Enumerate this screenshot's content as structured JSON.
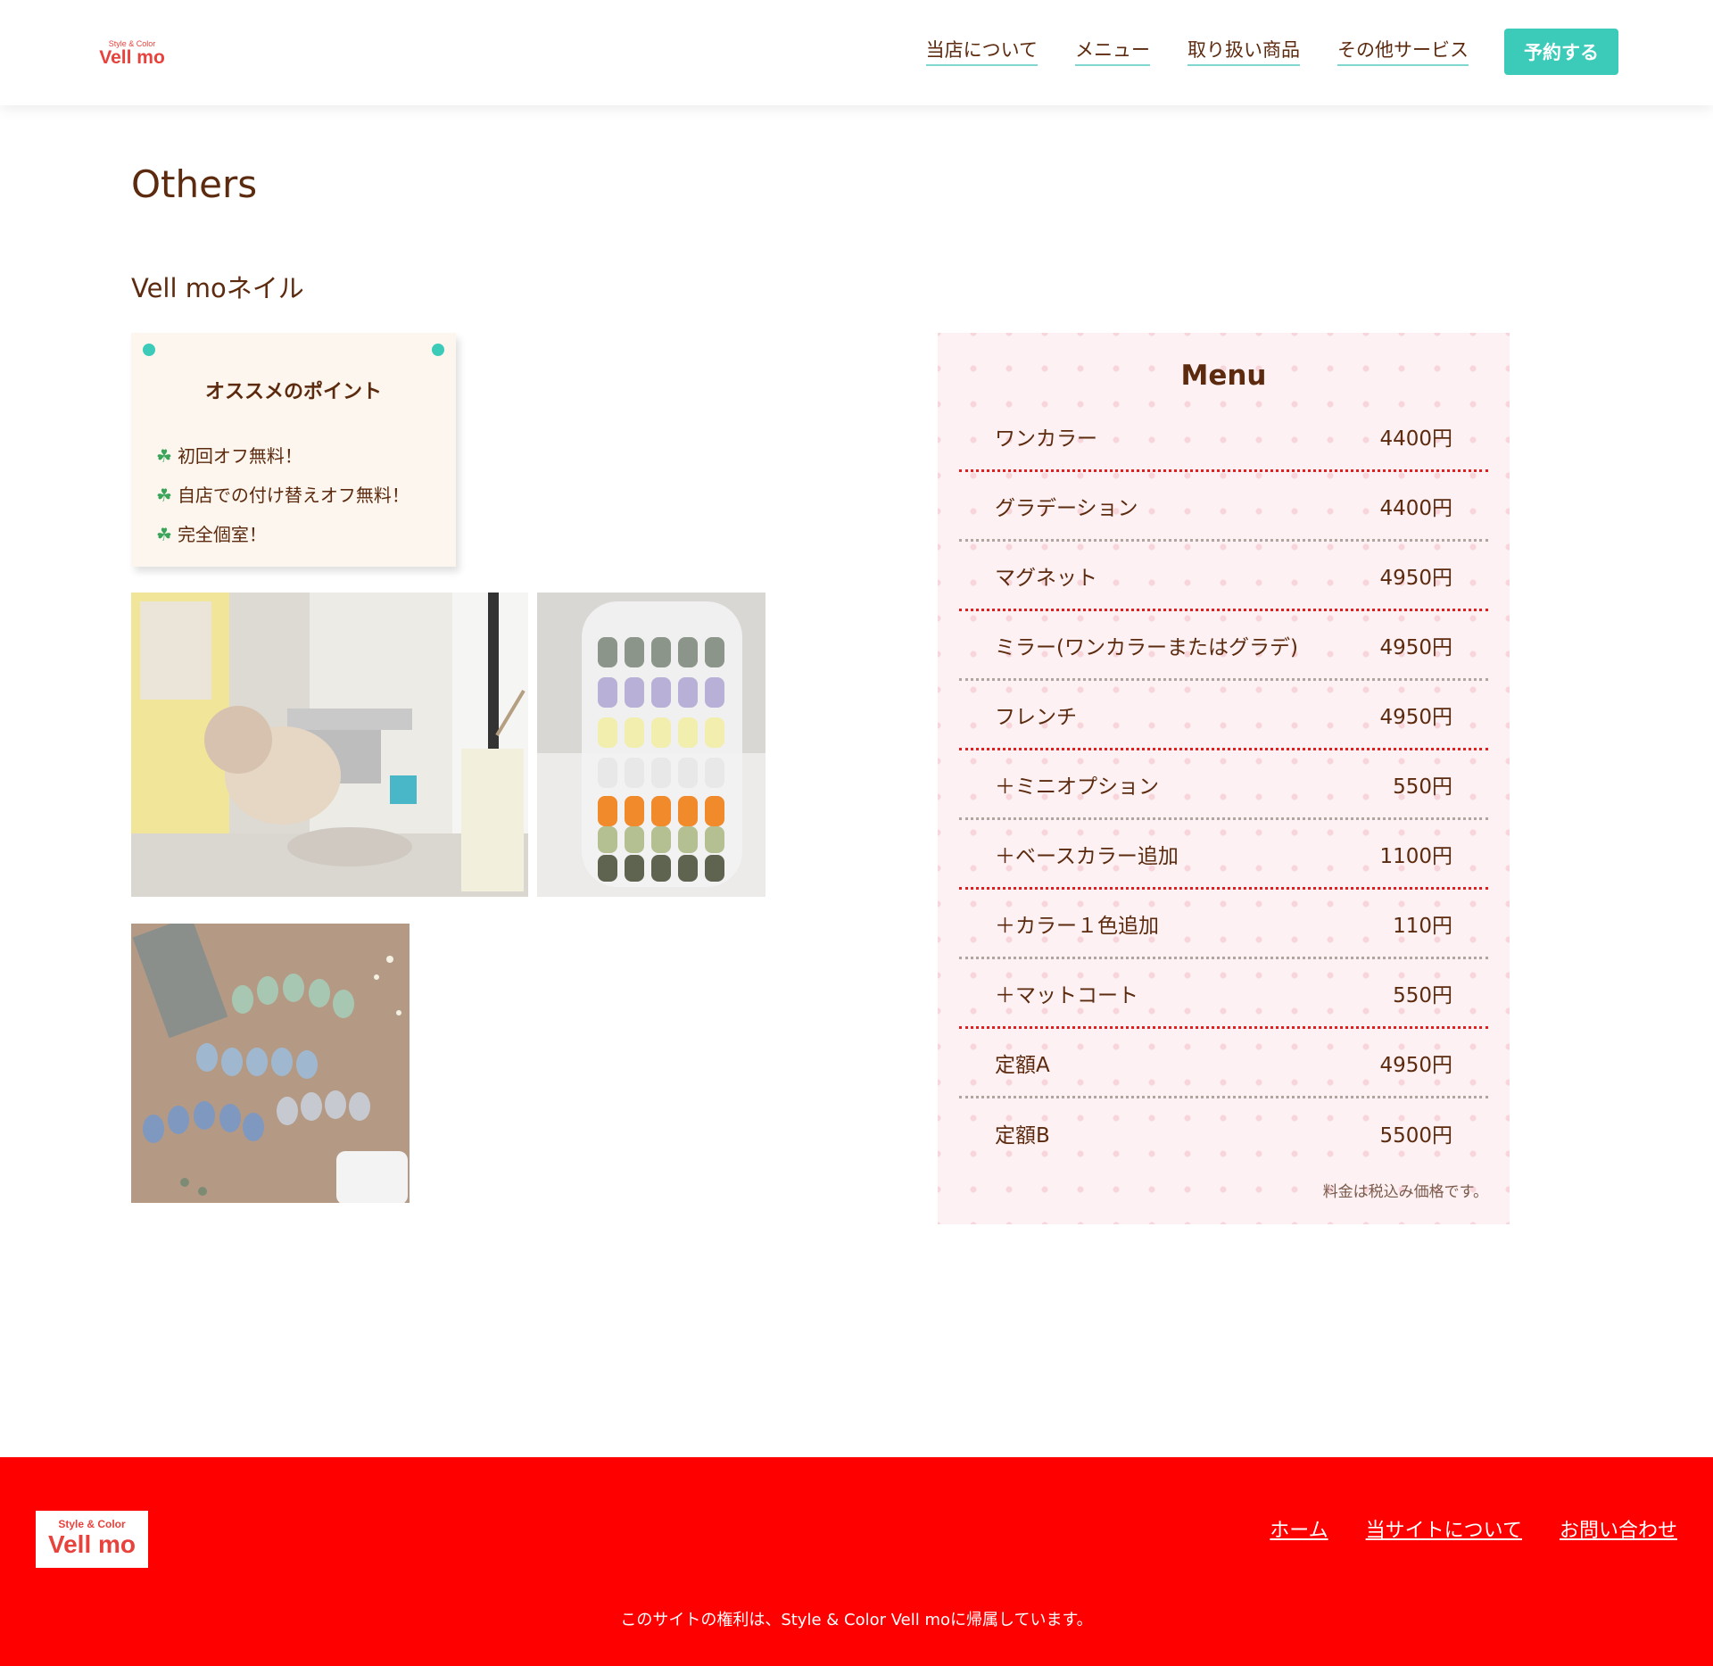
{
  "header": {
    "logo_sub": "Style & Color",
    "logo_main": "Vell mo",
    "nav": [
      "当店について",
      "メニュー",
      "取り扱い商品",
      "その他サービス"
    ],
    "reserve_label": "予約する"
  },
  "main": {
    "title": "Others",
    "section_title": "Vell moネイル",
    "recommend": {
      "title": "オススメのポイント",
      "items": [
        "初回オフ無料！",
        "自店での付け替えオフ無料！",
        "完全個室！"
      ]
    },
    "menu": {
      "title": "Menu",
      "items": [
        {
          "name": "ワンカラー",
          "price": "4400円"
        },
        {
          "name": "グラデーション",
          "price": "4400円"
        },
        {
          "name": "マグネット",
          "price": "4950円"
        },
        {
          "name": "ミラー(ワンカラーまたはグラデ)",
          "price": "4950円"
        },
        {
          "name": "フレンチ",
          "price": "4950円"
        },
        {
          "name": "＋ミニオプション",
          "price": "550円"
        },
        {
          "name": "＋ベースカラー追加",
          "price": "1100円"
        },
        {
          "name": "＋カラー１色追加",
          "price": "110円"
        },
        {
          "name": "＋マットコート",
          "price": "550円"
        },
        {
          "name": "定額A",
          "price": "4950円"
        },
        {
          "name": "定額B",
          "price": "5500円"
        }
      ],
      "note": "料金は税込み価格です。"
    }
  },
  "footer": {
    "logo_sub": "Style & Color",
    "logo_main": "Vell mo",
    "links": [
      "ホーム",
      "当サイトについて",
      "お問い合わせ"
    ],
    "copyright": "このサイトの権利は、Style & Color Vell moに帰属しています。"
  },
  "colors": {
    "accent": "#3ccab9",
    "brown_text": "#5c2a0e",
    "footer_red": "#ff0000",
    "logo_red": "#e8423c"
  }
}
